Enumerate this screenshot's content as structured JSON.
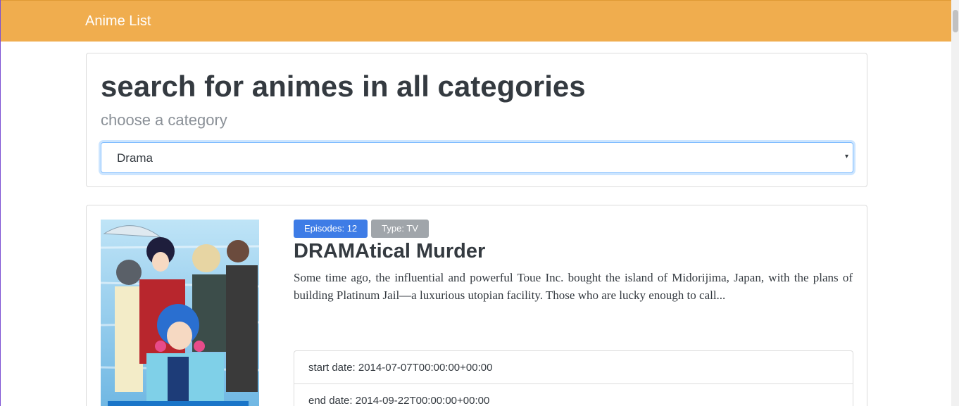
{
  "navbar": {
    "brand": "Anime List"
  },
  "search": {
    "title": "search for animes in all categories",
    "subtitle": "choose a category",
    "selected_category": "Drama"
  },
  "anime": {
    "badges": {
      "episodes": "Episodes: 12",
      "type": "Type: TV"
    },
    "title": "DRAMAtical Murder",
    "synopsis": "Some time ago, the influential and powerful Toue Inc. bought the island of Midorijima, Japan, with the plans of building Platinum Jail—a luxurious utopian facility. Those who are lucky enough to call...",
    "start_date": "start date: 2014-07-07T00:00:00+00:00",
    "end_date": "end date: 2014-09-22T00:00:00+00:00"
  },
  "colors": {
    "navbar": "#f0ad4e",
    "badge_primary": "#3e7ce6",
    "badge_secondary": "#a0a5aa"
  }
}
